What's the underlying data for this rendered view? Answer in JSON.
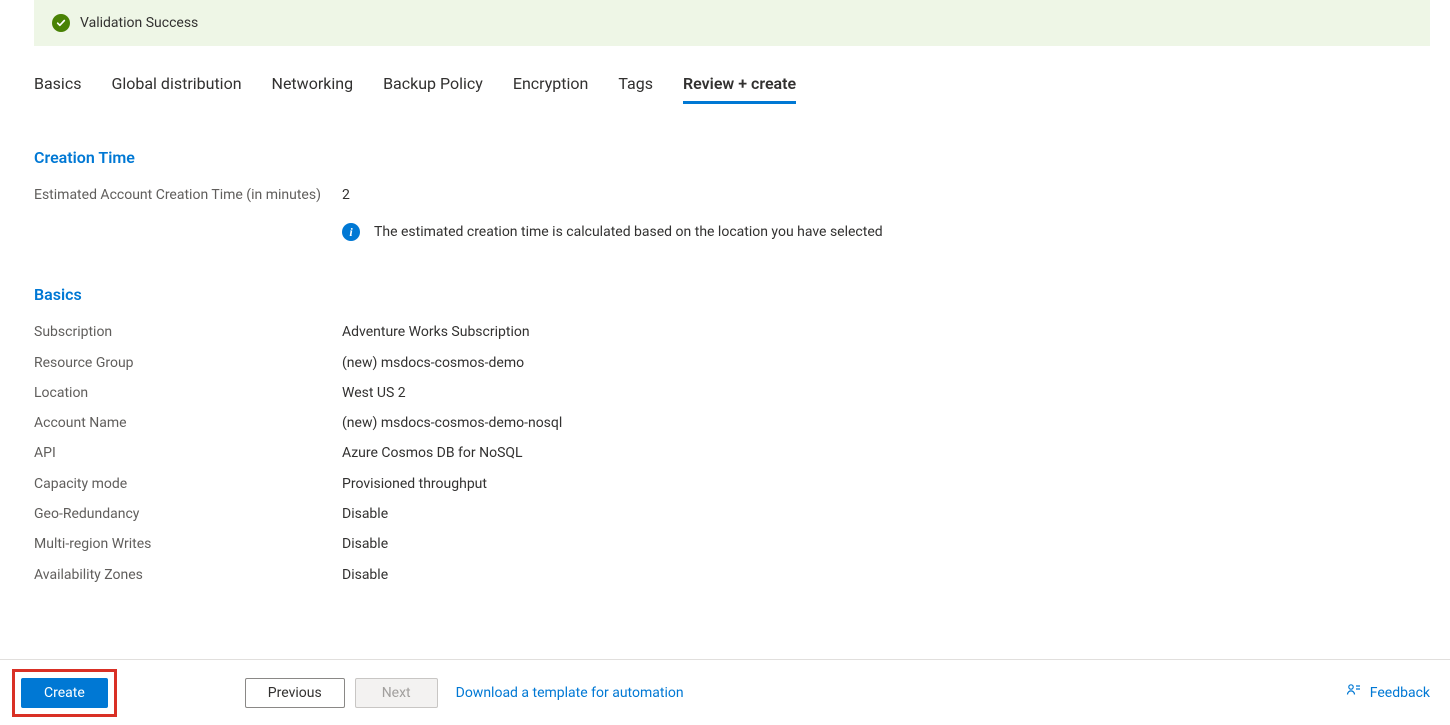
{
  "banner": {
    "text": "Validation Success"
  },
  "tabs": [
    {
      "label": "Basics",
      "active": false
    },
    {
      "label": "Global distribution",
      "active": false
    },
    {
      "label": "Networking",
      "active": false
    },
    {
      "label": "Backup Policy",
      "active": false
    },
    {
      "label": "Encryption",
      "active": false
    },
    {
      "label": "Tags",
      "active": false
    },
    {
      "label": "Review + create",
      "active": true
    }
  ],
  "sections": {
    "creation_time": {
      "heading": "Creation Time",
      "rows": [
        {
          "label": "Estimated Account Creation Time (in minutes)",
          "value": "2"
        }
      ],
      "info_note": "The estimated creation time is calculated based on the location you have selected"
    },
    "basics": {
      "heading": "Basics",
      "rows": [
        {
          "label": "Subscription",
          "value": "Adventure Works Subscription"
        },
        {
          "label": "Resource Group",
          "value": "(new) msdocs-cosmos-demo"
        },
        {
          "label": "Location",
          "value": "West US 2"
        },
        {
          "label": "Account Name",
          "value": "(new) msdocs-cosmos-demo-nosql"
        },
        {
          "label": "API",
          "value": "Azure Cosmos DB for NoSQL"
        },
        {
          "label": "Capacity mode",
          "value": "Provisioned throughput"
        },
        {
          "label": "Geo-Redundancy",
          "value": "Disable"
        },
        {
          "label": "Multi-region Writes",
          "value": "Disable"
        },
        {
          "label": "Availability Zones",
          "value": "Disable"
        }
      ]
    }
  },
  "footer": {
    "create_label": "Create",
    "previous_label": "Previous",
    "next_label": "Next",
    "download_template_label": "Download a template for automation",
    "feedback_label": "Feedback"
  }
}
